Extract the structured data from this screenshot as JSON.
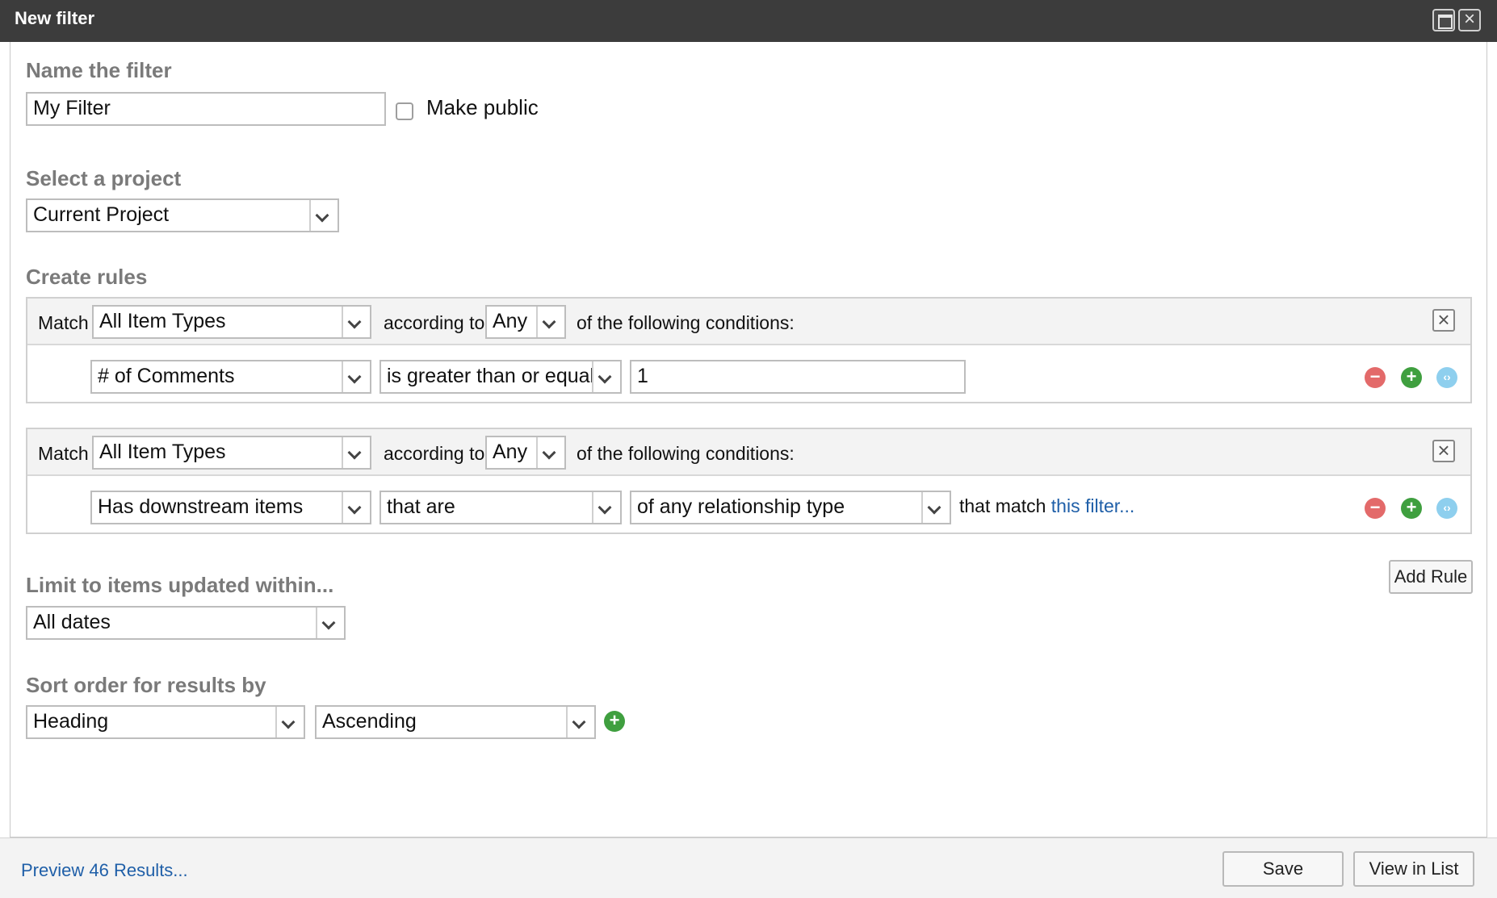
{
  "window": {
    "title": "New filter"
  },
  "name_section": {
    "label": "Name the filter",
    "name_value": "My Filter",
    "make_public_label": "Make public"
  },
  "project_section": {
    "label": "Select a project",
    "project_value": "Current Project"
  },
  "rules_section": {
    "label": "Create rules",
    "rules": [
      {
        "match_label": "Match",
        "item_types": "All Item Types",
        "according_to_label": "according to",
        "any_value": "Any",
        "conditions_label": "of the following conditions:",
        "condition": {
          "field": "# of Comments",
          "operator": "is greater than or equal",
          "value": "1"
        }
      },
      {
        "match_label": "Match",
        "item_types": "All Item Types",
        "according_to_label": "according to",
        "any_value": "Any",
        "conditions_label": "of the following conditions:",
        "condition": {
          "field": "Has downstream items",
          "operator": "that are",
          "relationship": "of any relationship type",
          "match_text": "that match",
          "filter_link": "this filter..."
        }
      }
    ],
    "add_rule_label": "Add Rule"
  },
  "limit_section": {
    "label": "Limit to items updated within...",
    "value": "All dates"
  },
  "sort_section": {
    "label": "Sort order for results by",
    "field": "Heading",
    "direction": "Ascending"
  },
  "footer": {
    "preview_link": "Preview 46 Results...",
    "save_label": "Save",
    "view_label": "View in List"
  },
  "icons": {
    "remove": "minus-circle-icon",
    "add": "plus-circle-icon",
    "nest": "code-circle-icon",
    "close": "close-icon",
    "maximize": "maximize-icon"
  },
  "colors": {
    "titlebar": "#3c3c3c",
    "section_label": "#7a7a7a",
    "link": "#1f5fa8",
    "remove_icon": "#e36a6a",
    "add_icon": "#3f9f3f",
    "nest_icon": "#8ecfee"
  }
}
